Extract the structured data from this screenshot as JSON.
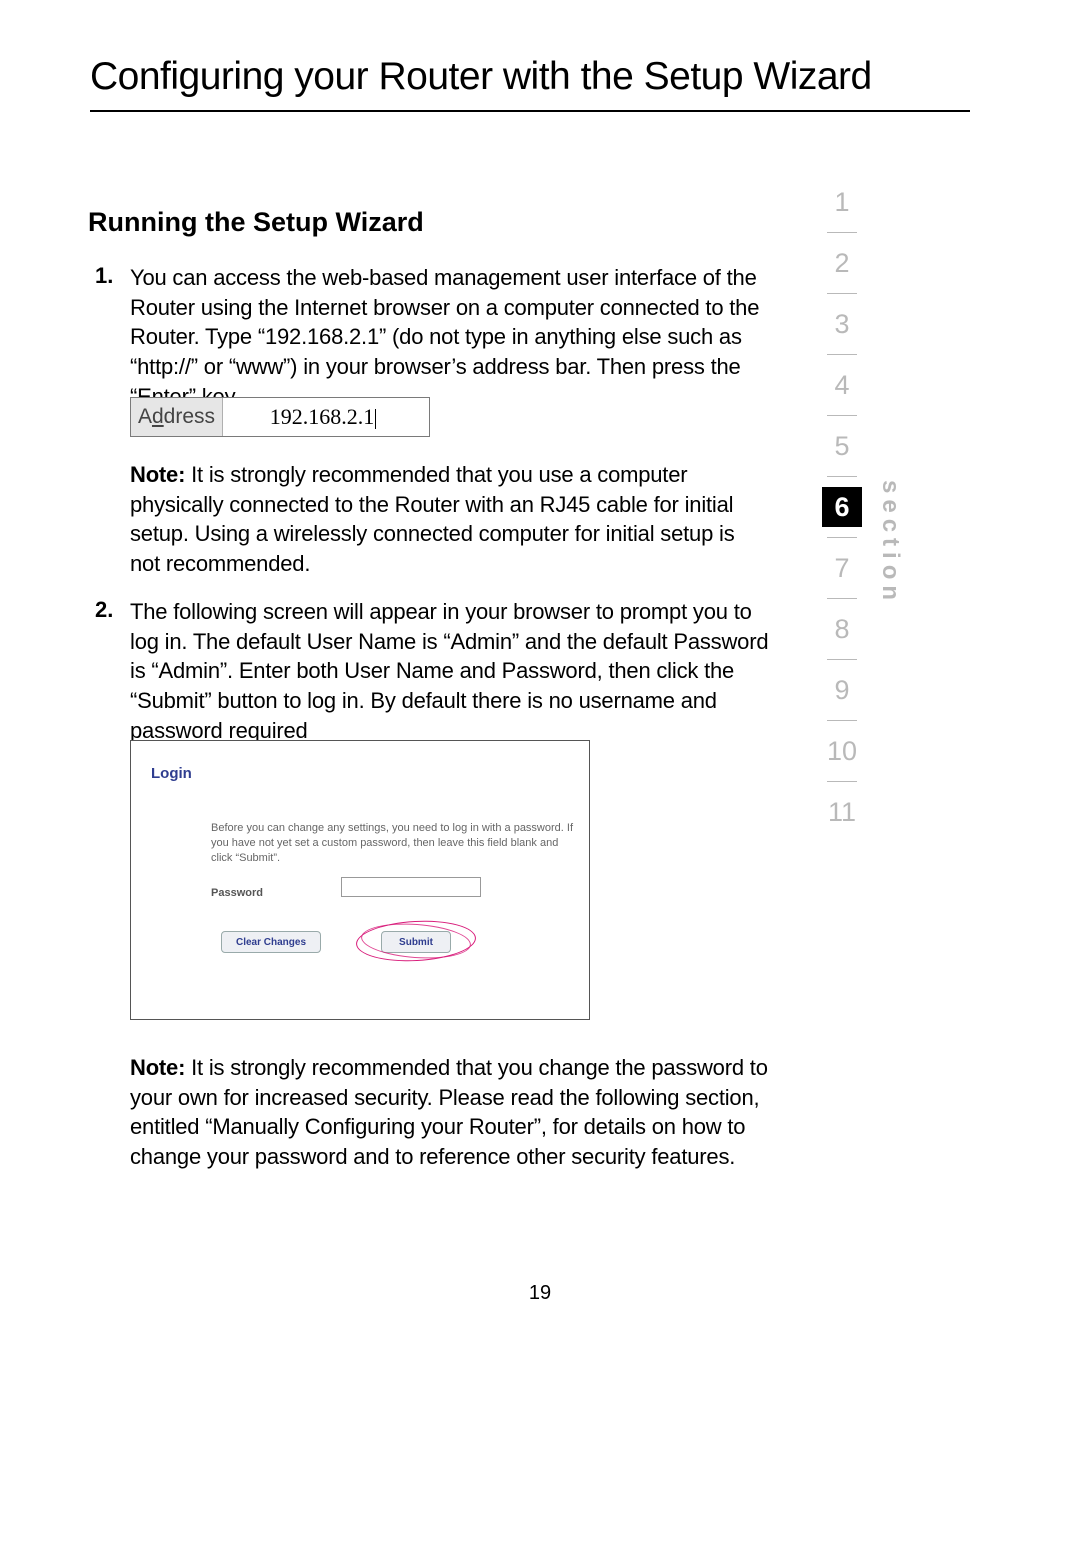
{
  "title": "Configuring your Router with the Setup Wizard",
  "subhead": "Running the Setup Wizard",
  "steps": {
    "n1": "1.",
    "p1": "You can access the web-based management user interface of the Router using the Internet browser on a computer connected to the Router. Type “192.168.2.1” (do not type in anything else such as “http://” or “www”) in your browser’s address bar. Then press the “Enter” key.",
    "n2": "2.",
    "p2": "The following screen will appear in your browser to prompt you to log in. The default User Name is “Admin” and the default Password is “Admin”. Enter both User Name and Password, then click the “Submit” button to log in. By default there is no username and password required"
  },
  "notes": {
    "label": "Note:",
    "note1_rest": " It is strongly recommended that you use a computer physically connected to the Router with an RJ45 cable for initial setup. Using a wirelessly connected computer for initial setup is not recommended.",
    "note2_rest": " It is strongly recommended that you change the password to your own for increased security. Please read the following section, entitled “Manually Configuring your Router”, for details on how to change your password and to reference other security features."
  },
  "addressbar": {
    "label_pre": "A",
    "label_u": "d",
    "label_post": "dress",
    "value": "192.168.2.1"
  },
  "loginshot": {
    "title": "Login",
    "msg": "Before you can change any settings, you need to log in with a password. If you have not yet set a custom password, then leave this field blank and click “Submit”.",
    "pwlabel": "Password",
    "clear": "Clear Changes",
    "submit": "Submit"
  },
  "nav": {
    "items": [
      "1",
      "2",
      "3",
      "4",
      "5",
      "6",
      "7",
      "8",
      "9",
      "10",
      "11"
    ],
    "active_index": 5,
    "section_word": "section"
  },
  "page_number": "19"
}
